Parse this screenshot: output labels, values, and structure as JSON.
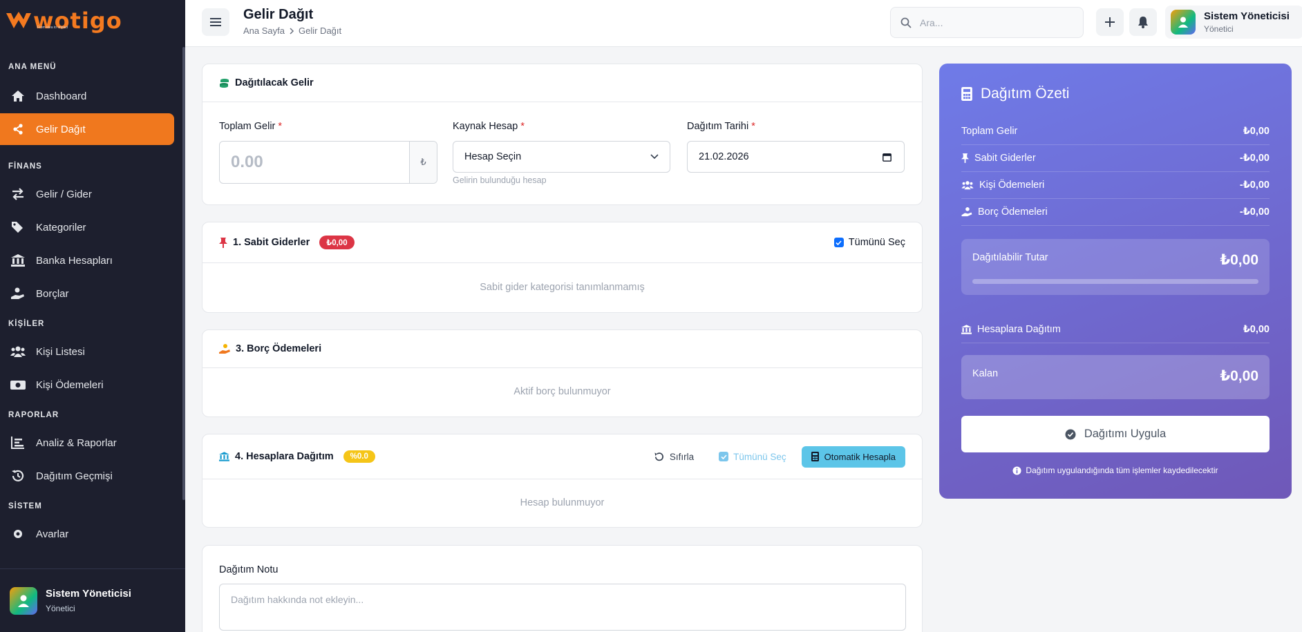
{
  "brand": {
    "name": "wotigo",
    "tagline": "From idea to impact"
  },
  "sidebar": {
    "sections": [
      {
        "title": "ANA MENÜ"
      },
      {
        "title": "FİNANS"
      },
      {
        "title": "KİŞİLER"
      },
      {
        "title": "RAPORLAR"
      },
      {
        "title": "SİSTEM"
      }
    ],
    "items": [
      {
        "label": "Dashboard",
        "icon": "home-icon"
      },
      {
        "label": "Gelir Dağıt",
        "icon": "share-icon",
        "active": true
      },
      {
        "label": "Gelir / Gider",
        "icon": "exchange-icon"
      },
      {
        "label": "Kategoriler",
        "icon": "tags-icon"
      },
      {
        "label": "Banka Hesapları",
        "icon": "bank-icon"
      },
      {
        "label": "Borçlar",
        "icon": "hand-coin-icon"
      },
      {
        "label": "Kişi Listesi",
        "icon": "users-icon"
      },
      {
        "label": "Kişi Ödemeleri",
        "icon": "money-icon"
      },
      {
        "label": "Analiz & Raporlar",
        "icon": "chart-icon"
      },
      {
        "label": "Dağıtım Geçmişi",
        "icon": "history-icon"
      },
      {
        "label": "Avarlar",
        "icon": "gear-icon"
      }
    ],
    "footer": {
      "name": "Sistem Yöneticisi",
      "role": "Yönetici"
    }
  },
  "topbar": {
    "title": "Gelir Dağıt",
    "breadcrumb": [
      "Ana Sayfa",
      "Gelir Dağıt"
    ],
    "search_placeholder": "Ara...",
    "user": {
      "name": "Sistem Yöneticisi",
      "role": "Yönetici"
    }
  },
  "income_card": {
    "title": "Dağıtılacak Gelir",
    "total_label": "Toplam Gelir",
    "total_placeholder": "0.00",
    "currency_symbol": "₺",
    "source_label": "Kaynak Hesap",
    "source_value": "Hesap Seçin",
    "source_helper": "Gelirin bulunduğu hesap",
    "date_label": "Dağıtım Tarihi",
    "date_value": "21.02.2026",
    "required_mark": "*"
  },
  "fixed_card": {
    "title": "1. Sabit Giderler",
    "badge": "₺0,00",
    "select_all": "Tümünü Seç",
    "empty": "Sabit gider kategorisi tanımlanmamış"
  },
  "debt_card": {
    "title": "3. Borç Ödemeleri",
    "empty": "Aktif borç bulunmuyor"
  },
  "accounts_card": {
    "title": "4. Hesaplara Dağıtım",
    "badge": "%0.0",
    "reset": "Sıfırla",
    "select_all": "Tümünü Seç",
    "auto_calc": "Otomatik Hesapla",
    "empty": "Hesap bulunmuyor"
  },
  "note_card": {
    "label": "Dağıtım Notu",
    "placeholder": "Dağıtım hakkında not ekleyin..."
  },
  "summary": {
    "title": "Dağıtım Özeti",
    "rows": [
      {
        "label": "Toplam Gelir",
        "value": "₺0,00"
      },
      {
        "label": "Sabit Giderler",
        "value": "-₺0,00"
      },
      {
        "label": "Kişi Ödemeleri",
        "value": "-₺0,00"
      },
      {
        "label": "Borç Ödemeleri",
        "value": "-₺0,00"
      }
    ],
    "distributable_label": "Dağıtılabilir Tutar",
    "distributable_value": "₺0,00",
    "distributable_progress": 0,
    "accounts_label": "Hesaplara Dağıtım",
    "accounts_value": "₺0,00",
    "remaining_label": "Kalan",
    "remaining_value": "₺0,00",
    "apply_button": "Dağıtımı Uygula",
    "note": "Dağıtım uygulandığında tüm işlemler kaydedilecektir"
  },
  "colors": {
    "accent": "#f0781e",
    "sidebar_bg": "#1d1f2e",
    "summary_from": "#6f7be8",
    "summary_to": "#6f58b8"
  }
}
